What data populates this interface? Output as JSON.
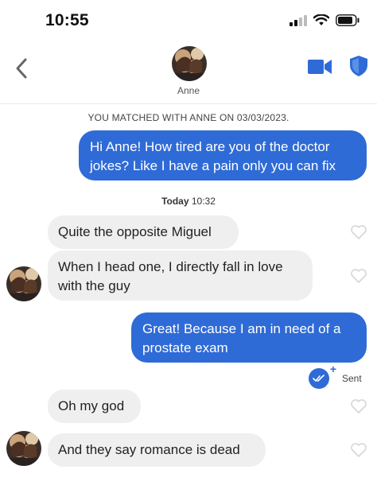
{
  "status_bar": {
    "time": "10:55"
  },
  "header": {
    "contact_name": "Anne"
  },
  "conversation": {
    "match_note": "YOU MATCHED WITH ANNE ON 03/03/2023.",
    "timestamp_day": "Today",
    "timestamp_time": "10:32",
    "messages": [
      {
        "direction": "outgoing",
        "text": "Hi Anne! How tired are you of the doctor\njokes? Like I have a pain only you can fix"
      },
      {
        "direction": "incoming",
        "text": "Quite the opposite Miguel"
      },
      {
        "direction": "incoming",
        "text": "When I head one, I directly fall in love\nwith the guy"
      },
      {
        "direction": "outgoing",
        "text": "Great! Because I am in need of a\nprostate exam"
      },
      {
        "direction": "incoming",
        "text": "Oh my god"
      },
      {
        "direction": "incoming",
        "text": "And they say romance is dead"
      }
    ],
    "sent_status": "Sent"
  },
  "icons": {
    "back": "chevron-left-icon",
    "video": "video-camera-icon",
    "shield": "shield-icon",
    "heart": "heart-outline-icon",
    "read_receipt": "double-check-icon"
  },
  "colors": {
    "accent_blue": "#2f6bd6",
    "incoming_bubble": "#efefef",
    "heart_outline": "#d6d6d6"
  }
}
